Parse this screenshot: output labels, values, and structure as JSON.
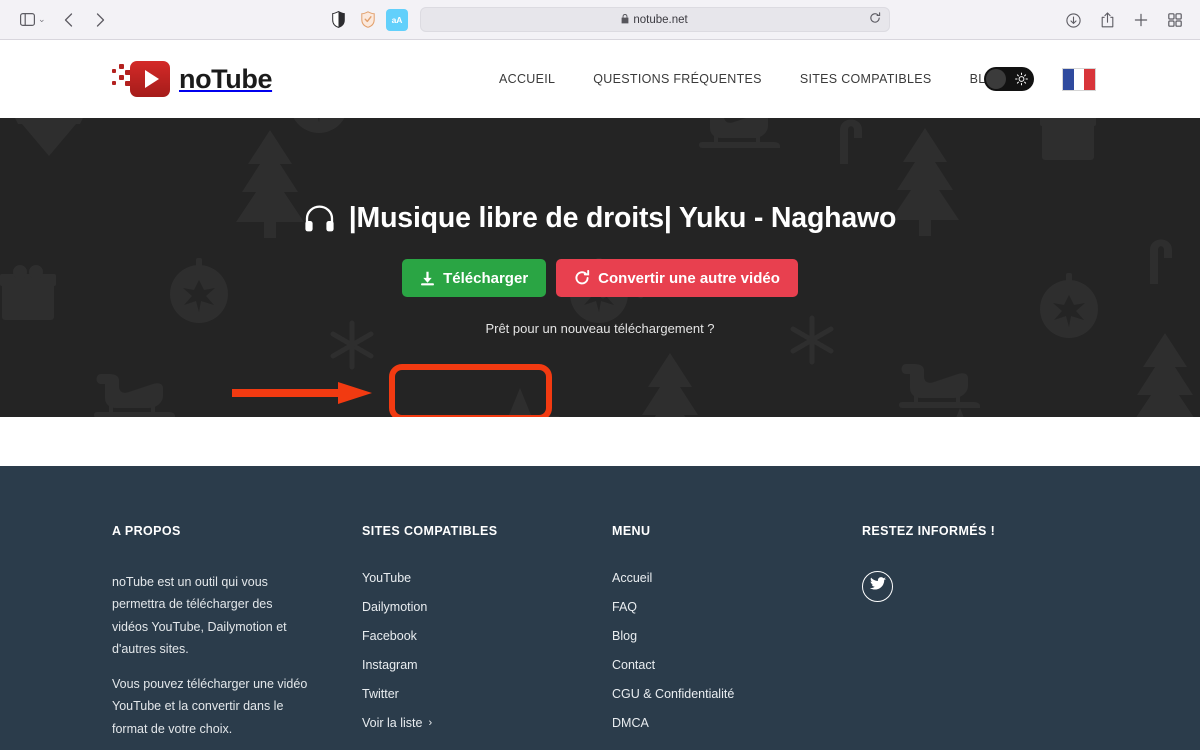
{
  "browser": {
    "sidebar_icon": "sidebar-icon",
    "sidebar_chevron": "⌄",
    "back_icon": "chevron-left-icon",
    "forward_icon": "chevron-right-icon",
    "privacy_icon": "contrast-icon",
    "shield_icon": "shield-icon",
    "reader_icon": "aA",
    "url": "notube.net",
    "lock_icon": "🔒",
    "reload_icon": "reload-icon",
    "downloads_icon": "downloads-icon",
    "share_icon": "share-icon",
    "new_tab_icon": "plus-icon",
    "tab_overview_icon": "grid-icon"
  },
  "header": {
    "logo_text": "noTube",
    "nav": [
      {
        "label": "ACCUEIL"
      },
      {
        "label": "QUESTIONS FRÉQUENTES"
      },
      {
        "label": "SITES COMPATIBLES"
      },
      {
        "label": "BLOG"
      }
    ],
    "theme_toggle": {
      "state": "dark",
      "icon": "sun-icon"
    },
    "language": {
      "flag": "fr",
      "label": "Français"
    }
  },
  "hero": {
    "headphone_icon": "headphones-icon",
    "title": "|Musique libre de droits| Yuku - Naghawo",
    "download_button": {
      "label": "Télécharger",
      "icon": "download-icon",
      "color": "#2aa544"
    },
    "convert_button": {
      "label": "Convertir une autre vidéo",
      "icon": "refresh-icon",
      "color": "#e8404f"
    },
    "subtitle": "Prêt pour un nouveau téléchargement ?",
    "background_theme": "christmas-pattern"
  },
  "annotation": {
    "color": "#f23a11",
    "highlight_target": "download-button",
    "arrow": "points-right-to-download-button"
  },
  "footer": {
    "columns": [
      {
        "title": "A PROPOS",
        "paragraphs": [
          "noTube est un outil qui vous permettra de télécharger des vidéos YouTube, Dailymotion et d'autres sites.",
          "Vous pouvez télécharger une vidéo YouTube et la convertir dans le format de votre choix."
        ]
      },
      {
        "title": "SITES COMPATIBLES",
        "links": [
          {
            "label": "YouTube"
          },
          {
            "label": "Dailymotion"
          },
          {
            "label": "Facebook"
          },
          {
            "label": "Instagram"
          },
          {
            "label": "Twitter"
          },
          {
            "label": "Voir la liste",
            "chevron": "›"
          }
        ]
      },
      {
        "title": "MENU",
        "links": [
          {
            "label": "Accueil"
          },
          {
            "label": "FAQ"
          },
          {
            "label": "Blog"
          },
          {
            "label": "Contact"
          },
          {
            "label": "CGU & Confidentialité"
          },
          {
            "label": "DMCA"
          }
        ]
      },
      {
        "title": "RESTEZ INFORMÉS !",
        "social": [
          {
            "label": "Twitter",
            "icon": "twitter-icon"
          }
        ]
      }
    ]
  },
  "colors": {
    "hero_bg": "#242424",
    "footer_bg": "#2b3c4b",
    "brand_red": "#c0211f",
    "annotation": "#f23a11"
  }
}
